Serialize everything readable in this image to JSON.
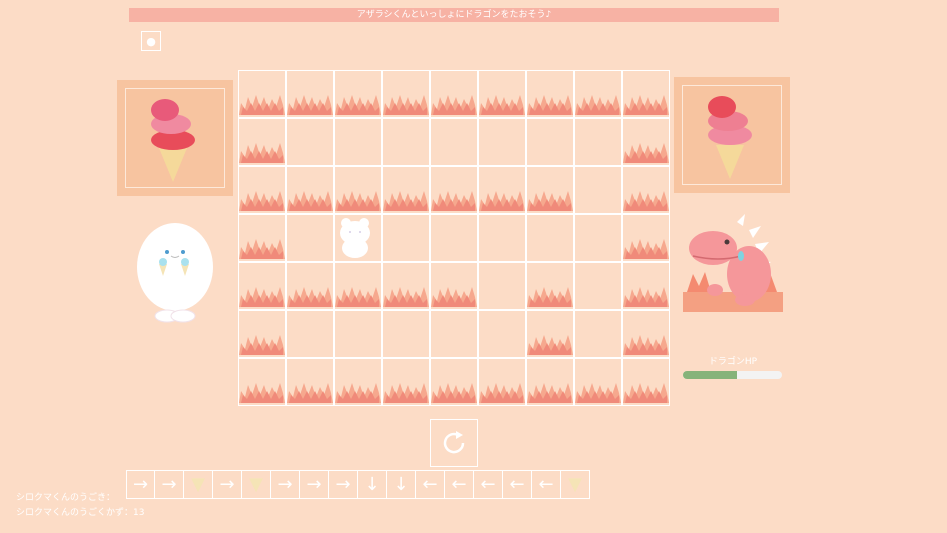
{
  "title": "アザラシくんといっしょにドラゴンをたおそう♪",
  "sound_button": {
    "icon": "bomb-icon",
    "glyph": "●"
  },
  "board": {
    "rows": 7,
    "cols": 9,
    "cells": [
      "FFFFFFFFF",
      "F.......F",
      "FFFFFFF.F",
      "F.......F",
      "FFFFF.F.F",
      "F.....F.F",
      "FFFFFFFFF"
    ],
    "player_icon": "white-bear-icon"
  },
  "dragon": {
    "hp_label": "ドラゴンHP",
    "hp_fraction": 0.55
  },
  "moves": [
    "→",
    "→",
    "▼",
    "→",
    "▼",
    "→",
    "→",
    "→",
    "↓",
    "↓",
    "←",
    "←",
    "←",
    "←",
    "←",
    "▼"
  ],
  "moves_label": "シロクマくんのうごき：",
  "moves_count": "シロクマくんのうごくかず：13",
  "colors": {
    "background": "#fcdcc6",
    "title_bar": "#f7b2a4",
    "fire": "#f08a7a",
    "hp_fill": "#86b37a"
  }
}
